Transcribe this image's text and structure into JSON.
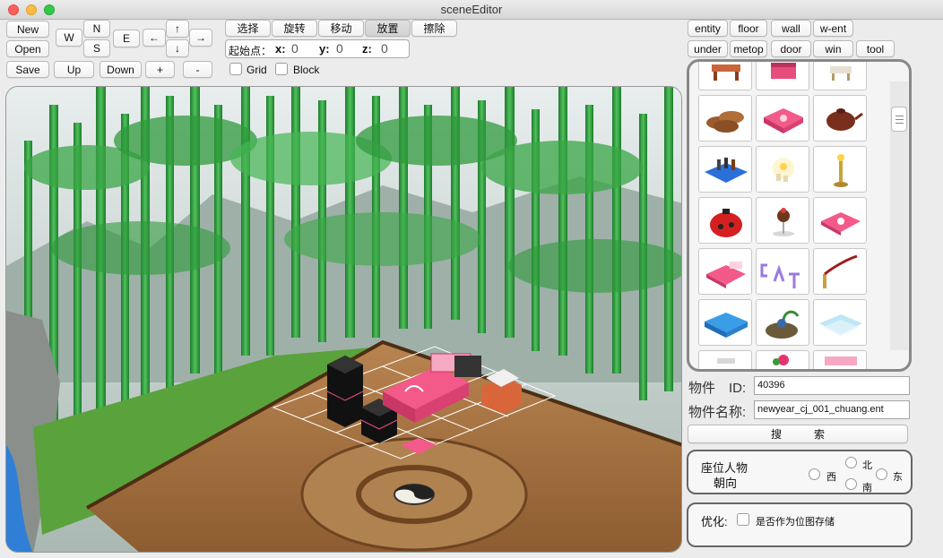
{
  "window": {
    "title": "sceneEditor"
  },
  "file_buttons": {
    "new": "New",
    "open": "Open",
    "save": "Save",
    "up": "Up",
    "down": "Down",
    "plus": "+",
    "minus": "-"
  },
  "nav": {
    "north": "N",
    "west": "W",
    "south": "S",
    "east": "E",
    "up_arrow": "↑",
    "down_arrow": "↓",
    "left_arrow": "←",
    "right_arrow": "→"
  },
  "modes": {
    "select": "选择",
    "rotate": "旋转",
    "move": "移动",
    "place": "放置",
    "erase": "擦除",
    "active": "放置"
  },
  "start_point": {
    "label": "起始点：",
    "x_label": "x:",
    "x": "0",
    "y_label": "y:",
    "y": "0",
    "z_label": "z:",
    "z": "0"
  },
  "toggles": {
    "grid": "Grid",
    "block": "Block"
  },
  "categories": {
    "row1": [
      "entity",
      "floor",
      "wall",
      "w-ent"
    ],
    "row2": [
      "under",
      "metop",
      "door",
      "win",
      "tool"
    ]
  },
  "palette": {
    "items": [
      "tea-table-icon",
      "pink-box-icon",
      "stool-icon",
      "cookie-stack-icon",
      "pink-cushion-icon",
      "teapot-icon",
      "bar-counter-icon",
      "candles-icon",
      "candlestick-icon",
      "red-kettle-icon",
      "cake-stand-icon",
      "pink-rug-icon",
      "pink-bed-icon",
      "cat-letters-icon",
      "rope-post-icon",
      "blue-tile-icon",
      "rock-icon",
      "glass-tile-icon",
      "misc-icon",
      "fruit-icon",
      "pink-block-icon"
    ]
  },
  "object": {
    "id_label": "物件　ID:",
    "id": "40396",
    "name_label": "物件名称:",
    "name": "newyear_cj_001_chuang.ent",
    "search": "搜　　　索"
  },
  "facing": {
    "label_line1": "座位人物",
    "label_line2": "朝向",
    "west": "西",
    "north": "北",
    "south": "南",
    "east": "东"
  },
  "optimize": {
    "label": "优化:",
    "bitmap": "是否作为位图存储"
  },
  "colors": {
    "bamboo": "#2f9a3c",
    "deck": "#a4703f",
    "bed": "#e94a7b"
  }
}
